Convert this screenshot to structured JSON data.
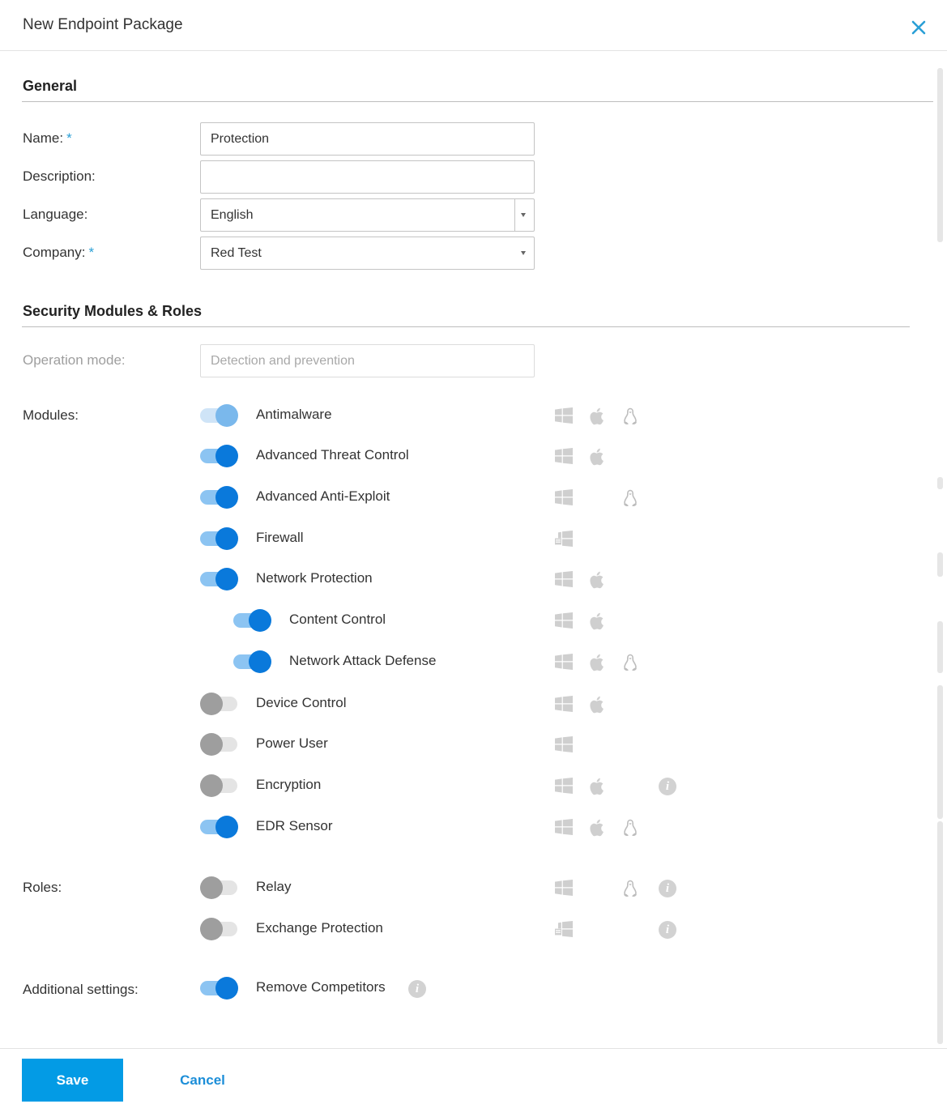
{
  "dialog": {
    "title": "New Endpoint Package",
    "close_icon": "close-icon",
    "accent_color": "#039be5",
    "toggle_on_color": "#0a79db",
    "toggle_off_color": "#9e9e9e"
  },
  "general": {
    "heading": "General",
    "name": {
      "label": "Name:",
      "required": "*",
      "value": "Protection"
    },
    "description": {
      "label": "Description:",
      "value": ""
    },
    "language": {
      "label": "Language:",
      "value": "English"
    },
    "company": {
      "label": "Company:",
      "required": "*",
      "value": "Red Test"
    }
  },
  "security": {
    "heading": "Security Modules & Roles",
    "operation_mode": {
      "label": "Operation mode:",
      "value": "Detection and prevention"
    },
    "modules_label": "Modules:",
    "modules": [
      {
        "label": "Antimalware",
        "enabled": true,
        "os": [
          "windows",
          "mac",
          "linux"
        ]
      },
      {
        "label": "Advanced Threat Control",
        "enabled": true,
        "os": [
          "windows",
          "mac"
        ]
      },
      {
        "label": "Advanced Anti-Exploit",
        "enabled": true,
        "os": [
          "windows",
          "linux"
        ]
      },
      {
        "label": "Firewall",
        "enabled": true,
        "os": [
          "windows-server"
        ]
      },
      {
        "label": "Network Protection",
        "enabled": true,
        "os": [
          "windows",
          "mac"
        ]
      },
      {
        "label": "Content Control",
        "enabled": true,
        "os": [
          "windows",
          "mac"
        ]
      },
      {
        "label": "Network Attack Defense",
        "enabled": true,
        "os": [
          "windows",
          "mac",
          "linux"
        ]
      },
      {
        "label": "Device Control",
        "enabled": false,
        "os": [
          "windows",
          "mac"
        ]
      },
      {
        "label": "Power User",
        "enabled": false,
        "os": [
          "windows"
        ]
      },
      {
        "label": "Encryption",
        "enabled": false,
        "os": [
          "windows",
          "mac"
        ]
      },
      {
        "label": "EDR Sensor",
        "enabled": true,
        "os": [
          "windows",
          "mac",
          "linux"
        ]
      }
    ],
    "roles_label": "Roles:",
    "roles": [
      {
        "label": "Relay",
        "enabled": false,
        "os": [
          "windows",
          "linux"
        ]
      },
      {
        "label": "Exchange Protection",
        "enabled": false,
        "os": [
          "windows-server"
        ]
      }
    ],
    "additional_label": "Additional settings:",
    "additional": [
      {
        "label": "Remove Competitors",
        "enabled": true
      }
    ]
  },
  "footer": {
    "save_label": "Save",
    "cancel_label": "Cancel"
  }
}
